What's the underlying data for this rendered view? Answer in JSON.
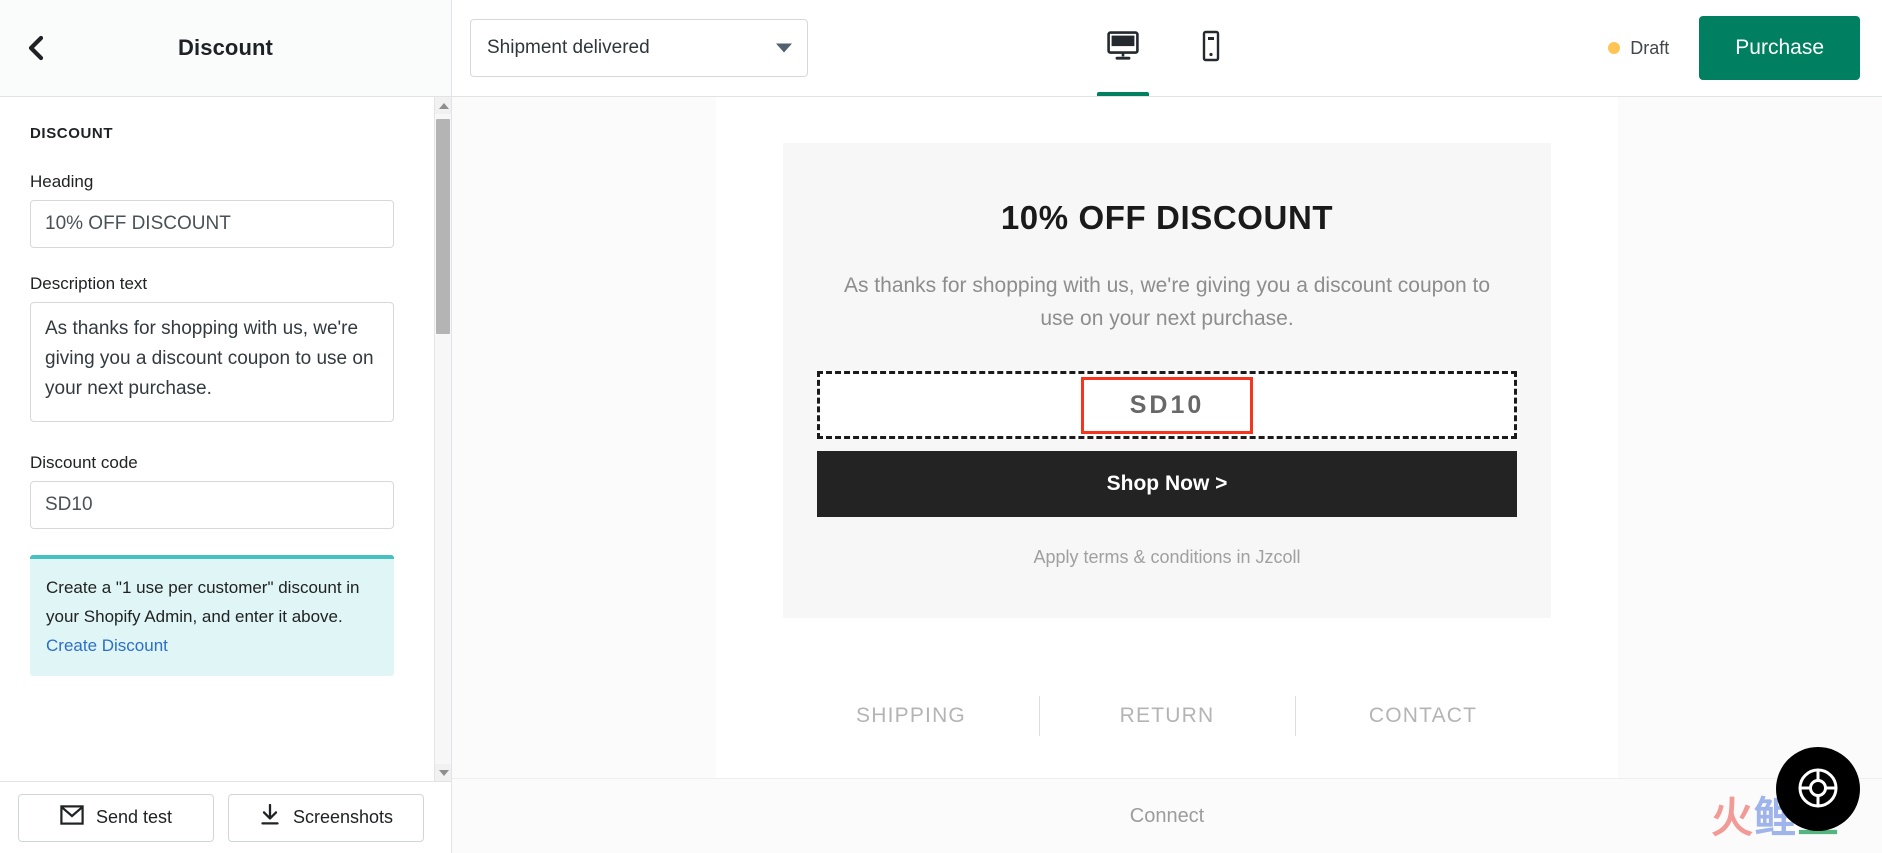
{
  "sidebar": {
    "back_icon": "chevron-left-icon",
    "title": "Discount",
    "section_label": "DISCOUNT",
    "fields": {
      "heading": {
        "label": "Heading",
        "value": "10% OFF DISCOUNT"
      },
      "description": {
        "label": "Description text",
        "value": "As thanks for shopping with us, we're giving you a discount coupon to use on your next purchase."
      },
      "discount_code": {
        "label": "Discount code",
        "value": "SD10"
      }
    },
    "callout": {
      "text": "Create a \"1 use per customer\" discount in your Shopify Admin, and enter it above.",
      "link_label": "Create Discount",
      "accent_color": "#47c1bf",
      "background_color": "#e0f5f5"
    },
    "footer": {
      "send_test_label": "Send test",
      "send_test_icon": "envelope-icon",
      "screenshots_label": "Screenshots",
      "screenshots_icon": "download-icon"
    }
  },
  "topbar": {
    "trigger_select": {
      "value": "Shipment delivered",
      "caret_icon": "chevron-down-icon"
    },
    "device_tabs": [
      {
        "name": "desktop",
        "icon": "desktop-monitor-icon",
        "active": true
      },
      {
        "name": "mobile",
        "icon": "mobile-device-icon",
        "active": false
      }
    ],
    "status": {
      "label": "Draft",
      "dot_color": "#ffc453"
    },
    "primary_button": {
      "label": "Purchase",
      "color": "#008060"
    }
  },
  "preview": {
    "discount_card": {
      "heading": "10% OFF DISCOUNT",
      "description": "As thanks for shopping with us, we're giving you a discount coupon to use on your next purchase.",
      "coupon_code": "SD10",
      "coupon_border_color": "#f5361f",
      "cta_label": "Shop Now >",
      "cta_background": "#232323",
      "terms": "Apply terms & conditions in Jzcoll"
    },
    "footer_links": [
      "SHIPPING",
      "RETURN",
      "CONTACT"
    ],
    "connect_label": "Connect"
  },
  "widgets": {
    "help_button": {
      "icon": "life-ring-icon"
    },
    "watermark": {
      "char1": "火",
      "char2": "鲤",
      "char3": "鱼"
    }
  }
}
